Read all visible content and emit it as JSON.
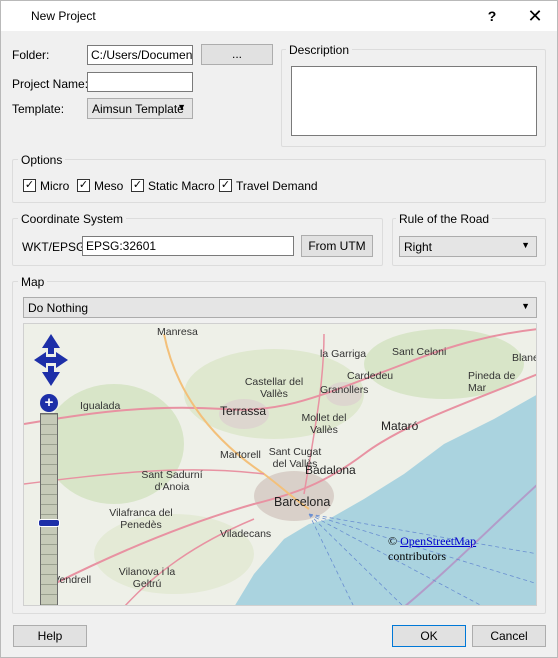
{
  "window": {
    "title": "New Project",
    "help_glyph": "?",
    "close_glyph": "✕"
  },
  "form": {
    "folder_label": "Folder:",
    "folder_value": "C:/Users/Documents",
    "browse_label": "...",
    "project_name_label": "Project Name:",
    "project_name_value": "",
    "template_label": "Template:",
    "template_value": "Aimsun Template"
  },
  "description": {
    "title": "Description",
    "value": ""
  },
  "options": {
    "title": "Options",
    "items": [
      {
        "label": "Micro",
        "checked": true
      },
      {
        "label": "Meso",
        "checked": true
      },
      {
        "label": "Static Macro",
        "checked": true
      },
      {
        "label": "Travel Demand",
        "checked": true
      }
    ]
  },
  "coordinate_system": {
    "title": "Coordinate System",
    "wkt_label": "WKT/EPSG:",
    "wkt_value": "EPSG:32601",
    "from_utm_label": "From UTM"
  },
  "rule_of_road": {
    "title": "Rule of the Road",
    "value": "Right"
  },
  "map": {
    "title": "Map",
    "action_value": "Do Nothing",
    "attribution_prefix": "© ",
    "attribution_link": "OpenStreetMap",
    "attribution_suffix": " contributors",
    "places": [
      "Manresa",
      "la Garriga",
      "Sant Celoni",
      "Blanes",
      "Cardedeu",
      "Pineda de Mar",
      "Castellar del Vallès",
      "Granollers",
      "Igualada",
      "Terrassa",
      "Mollet del Vallès",
      "Mataró",
      "Martorell",
      "Sant Cugat del Vallès",
      "Badalona",
      "Sant Sadurní d'Anoia",
      "Barcelona",
      "Vilafranca del Penedès",
      "Viladecans",
      "el Vendrell",
      "Vilanova i la Geltrú"
    ]
  },
  "footer": {
    "help_label": "Help",
    "ok_label": "OK",
    "cancel_label": "Cancel"
  }
}
